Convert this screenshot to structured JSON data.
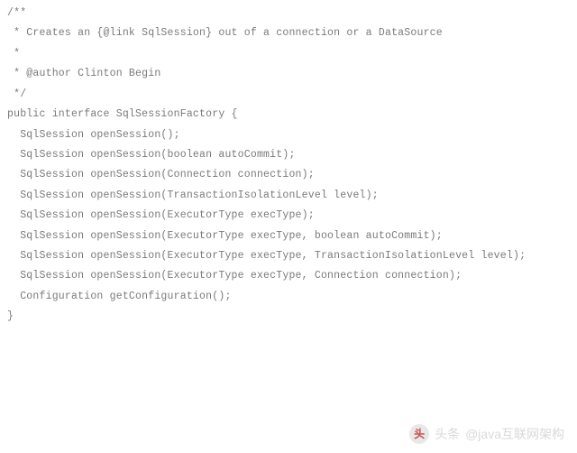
{
  "code": {
    "lines": [
      "/**",
      " * Creates an {@link SqlSession} out of a connection or a DataSource",
      " *",
      " * @author Clinton Begin",
      " */",
      "public interface SqlSessionFactory {",
      "",
      "  SqlSession openSession();",
      "",
      "  SqlSession openSession(boolean autoCommit);",
      "  SqlSession openSession(Connection connection);",
      "  SqlSession openSession(TransactionIsolationLevel level);",
      "",
      "  SqlSession openSession(ExecutorType execType);",
      "  SqlSession openSession(ExecutorType execType, boolean autoCommit);",
      "  SqlSession openSession(ExecutorType execType, TransactionIsolationLevel level);",
      "  SqlSession openSession(ExecutorType execType, Connection connection);",
      "",
      "  Configuration getConfiguration();",
      "",
      "}"
    ]
  },
  "attribution": {
    "prefix": "头条",
    "handle": "@java互联网架构",
    "logo_glyph": "头"
  }
}
